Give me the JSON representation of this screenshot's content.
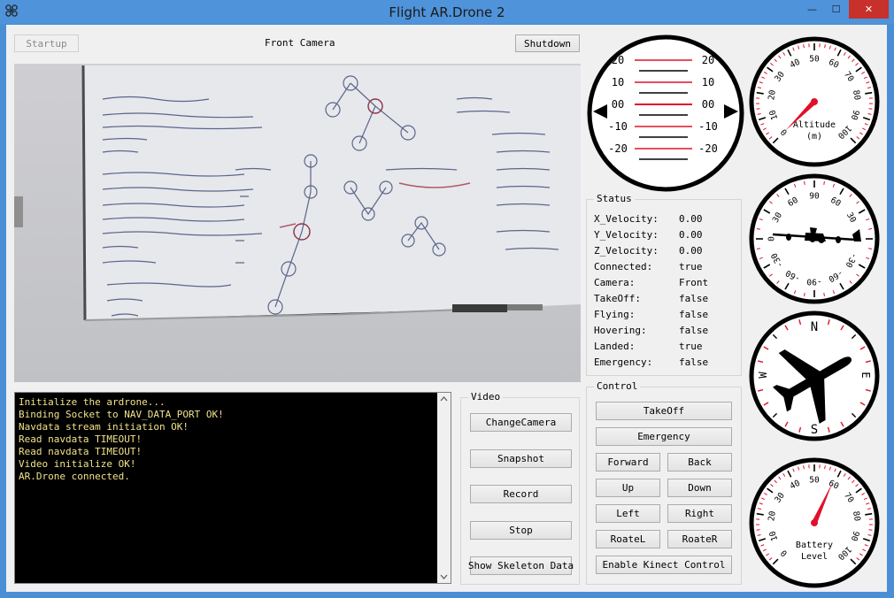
{
  "window": {
    "title": "Flight AR.Drone 2",
    "minimize": "—",
    "maximize": "☐",
    "close": "✕"
  },
  "top_bar": {
    "startup_label": "Startup",
    "camera_label": "Front Camera",
    "shutdown_label": "Shutdown"
  },
  "console": {
    "lines": [
      "Initialize the ardrone...",
      "Binding Socket to NAV_DATA_PORT OK!",
      "Navdata stream initiation OK!",
      "Read navdata TIMEOUT!",
      "Read navdata TIMEOUT!",
      "Video initialize OK!",
      "AR.Drone connected."
    ]
  },
  "video": {
    "title": "Video",
    "buttons": [
      "ChangeCamera",
      "Snapshot",
      "Record",
      "Stop",
      "Show Skeleton Data"
    ]
  },
  "status": {
    "title": "Status",
    "rows": [
      {
        "key": "X_Velocity:",
        "value": "0.00"
      },
      {
        "key": "Y_Velocity:",
        "value": "0.00"
      },
      {
        "key": "Z_Velocity:",
        "value": "0.00"
      },
      {
        "key": "Connected:",
        "value": "true"
      },
      {
        "key": "Camera:",
        "value": "Front"
      },
      {
        "key": "TakeOff:",
        "value": "false"
      },
      {
        "key": "Flying:",
        "value": "false"
      },
      {
        "key": "Hovering:",
        "value": "false"
      },
      {
        "key": "Landed:",
        "value": "true"
      },
      {
        "key": "Emergency:",
        "value": "false"
      }
    ]
  },
  "control": {
    "title": "Control",
    "takeoff": "TakeOff",
    "emergency": "Emergency",
    "forward": "Forward",
    "back": "Back",
    "up": "Up",
    "down": "Down",
    "left": "Left",
    "right": "Right",
    "rotate_left": "RoateL",
    "rotate_right": "RoateR",
    "kinect": "Enable Kinect Control"
  },
  "gauges": {
    "attitude": {
      "scale_left": [
        "20",
        "10",
        "00",
        "-10",
        "-20"
      ],
      "scale_right": [
        "20",
        "10",
        "00",
        "-10",
        "-20"
      ]
    },
    "altitude": {
      "label_line1": "Altitude",
      "label_line2": "(m)",
      "ticks": [
        "0",
        "10",
        "20",
        "30",
        "40",
        "50",
        "60",
        "70",
        "80",
        "90",
        "100"
      ],
      "value": 0
    },
    "heading_dial": {
      "ticks": [
        "0",
        "30",
        "60",
        "90",
        "60",
        "30",
        "0",
        "-30",
        "-60",
        "-90",
        "-60",
        "-30"
      ]
    },
    "compass": {
      "n": "N",
      "s": "S",
      "e": "E",
      "w": "W"
    },
    "battery": {
      "label_line1": "Battery",
      "label_line2": "Level",
      "ticks": [
        "0",
        "10",
        "20",
        "30",
        "40",
        "50",
        "60",
        "70",
        "80",
        "90",
        "100"
      ],
      "value": 59
    }
  },
  "colors": {
    "title_bar": "#4f93da",
    "close_button": "#c7302b",
    "console_text": "#f2e38a",
    "gauge_red": "#e0112b"
  }
}
